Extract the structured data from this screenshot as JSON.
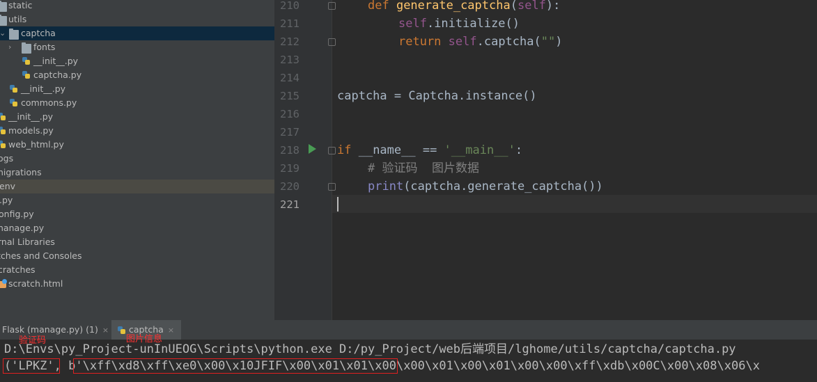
{
  "sidebar": {
    "items": [
      {
        "label": "static"
      },
      {
        "label": "utils"
      },
      {
        "label": "captcha"
      },
      {
        "label": "fonts"
      },
      {
        "label": "__init__.py"
      },
      {
        "label": "captcha.py"
      },
      {
        "label": "__init__.py"
      },
      {
        "label": "commons.py"
      },
      {
        "label": "__init__.py"
      },
      {
        "label": "models.py"
      },
      {
        "label": "web_html.py"
      },
      {
        "label": "ogs"
      },
      {
        "label": "nigrations"
      },
      {
        "label": "env"
      },
      {
        "label": ".py"
      },
      {
        "label": "onfig.py"
      },
      {
        "label": "nanage.py"
      },
      {
        "label": "rnal Libraries"
      },
      {
        "label": "tches and Consoles"
      },
      {
        "label": "cratches"
      },
      {
        "label": "scratch.html"
      }
    ]
  },
  "editor": {
    "line_numbers": [
      "210",
      "211",
      "212",
      "213",
      "214",
      "215",
      "216",
      "217",
      "218",
      "219",
      "220",
      "221"
    ],
    "lines": {
      "l210": {
        "kw": "def ",
        "fn": "generate_captcha",
        "p1": "(",
        "self": "self",
        "p2": "):"
      },
      "l211": {
        "self": "self",
        "rest": ".initialize()"
      },
      "l212": {
        "kw": "return ",
        "self": "self",
        "mid": ".captcha(",
        "str": "\"\"",
        "end": ")"
      },
      "l215": {
        "text": "captcha = Captcha.instance()"
      },
      "l218": {
        "kw": "if ",
        "mid": "__name__ == ",
        "str": "'__main__'",
        "end": ":"
      },
      "l219": {
        "comment": "# 验证码  图片数据"
      },
      "l220": {
        "bi": "print",
        "rest": "(captcha.generate_captcha())"
      }
    }
  },
  "run_panel": {
    "tabs": [
      {
        "label": "Flask (manage.py) (1)",
        "close": "×"
      },
      {
        "label": "captcha",
        "close": "×"
      }
    ],
    "console": {
      "line1": "D:\\Envs\\py_Project-unInUEOG\\Scripts\\python.exe D:/py_Project/web后端项目/lghome/utils/captcha/captcha.py",
      "part_a": "('LPKZ'",
      "part_sep": ", ",
      "part_b": "b'\\xff\\xd8\\xff\\xe0\\x00\\x10JFIF\\x00\\x01\\x01",
      "part_c": "\\x00\\x00\\x01\\x00\\x01\\x00\\x00\\xff\\xdb\\x00C\\x00\\x08\\x06\\x"
    }
  },
  "annotations": {
    "label_captcha": "验证码",
    "label_image": "图片信息"
  },
  "colors": {
    "keyword": "#cc7832",
    "function": "#ffc66d",
    "self": "#94558d",
    "string": "#6a8759",
    "comment": "#808080",
    "builtin": "#8888c6",
    "annotation_red": "#e02020"
  }
}
